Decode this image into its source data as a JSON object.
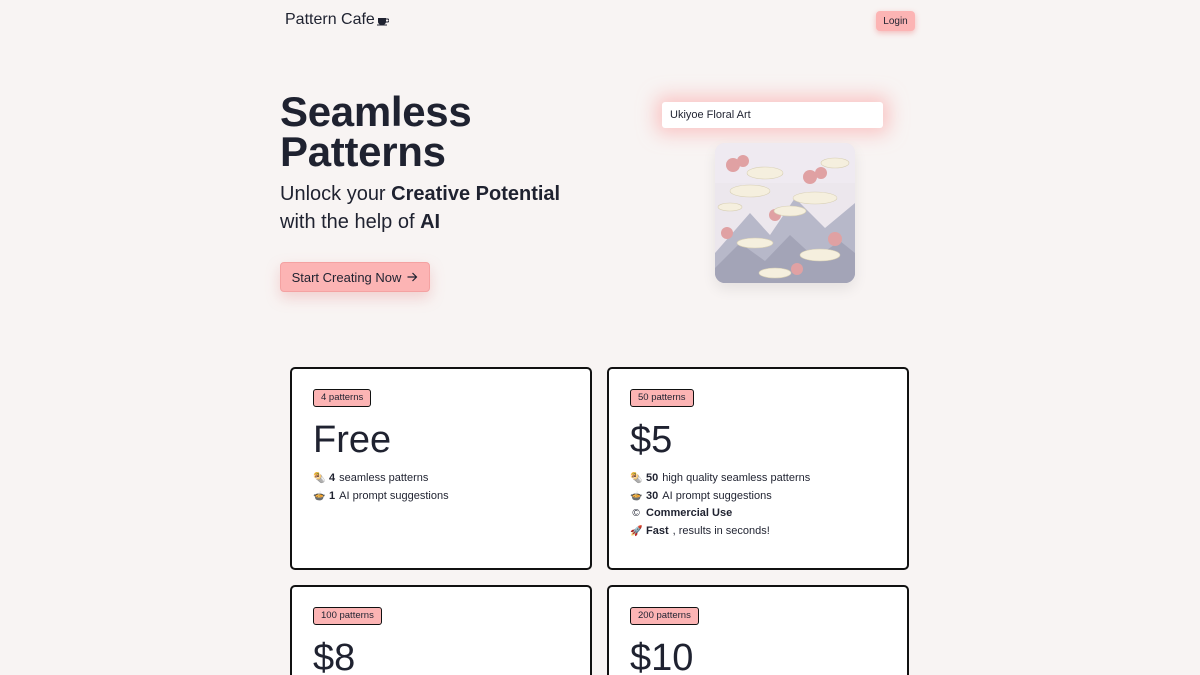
{
  "header": {
    "logo_text": "Pattern Cafe",
    "login_label": "Login"
  },
  "hero": {
    "title_line1": "Seamless",
    "title_line2": "Patterns",
    "sub_line1_prefix": "Unlock your ",
    "sub_line1_bold": "Creative Potential",
    "sub_line2_prefix": "with the help of ",
    "sub_line2_bold": "AI",
    "cta_label": "Start Creating Now"
  },
  "prompt": {
    "value": "Ukiyoe Floral Art"
  },
  "colors": {
    "accent": "#fcb4b4",
    "background": "#f8f4f3",
    "text": "#1f2230"
  },
  "plans": [
    {
      "badge": "4 patterns",
      "price": "Free",
      "features": [
        {
          "icon": "🌯",
          "bold": "4",
          "text": " seamless patterns"
        },
        {
          "icon": "🍲",
          "bold": "1",
          "text": " AI prompt suggestions"
        }
      ]
    },
    {
      "badge": "50 patterns",
      "price": "$5",
      "features": [
        {
          "icon": "🌯",
          "bold": "50",
          "text": " high quality seamless patterns"
        },
        {
          "icon": "🍲",
          "bold": "30",
          "text": " AI prompt suggestions"
        },
        {
          "icon": "©",
          "bold": "Commercial Use",
          "text": ""
        },
        {
          "icon": "🚀",
          "bold": "Fast",
          "text": ", results in seconds!"
        }
      ]
    },
    {
      "badge": "100 patterns",
      "price": "$8",
      "features": []
    },
    {
      "badge": "200 patterns",
      "price": "$10",
      "features": []
    }
  ]
}
